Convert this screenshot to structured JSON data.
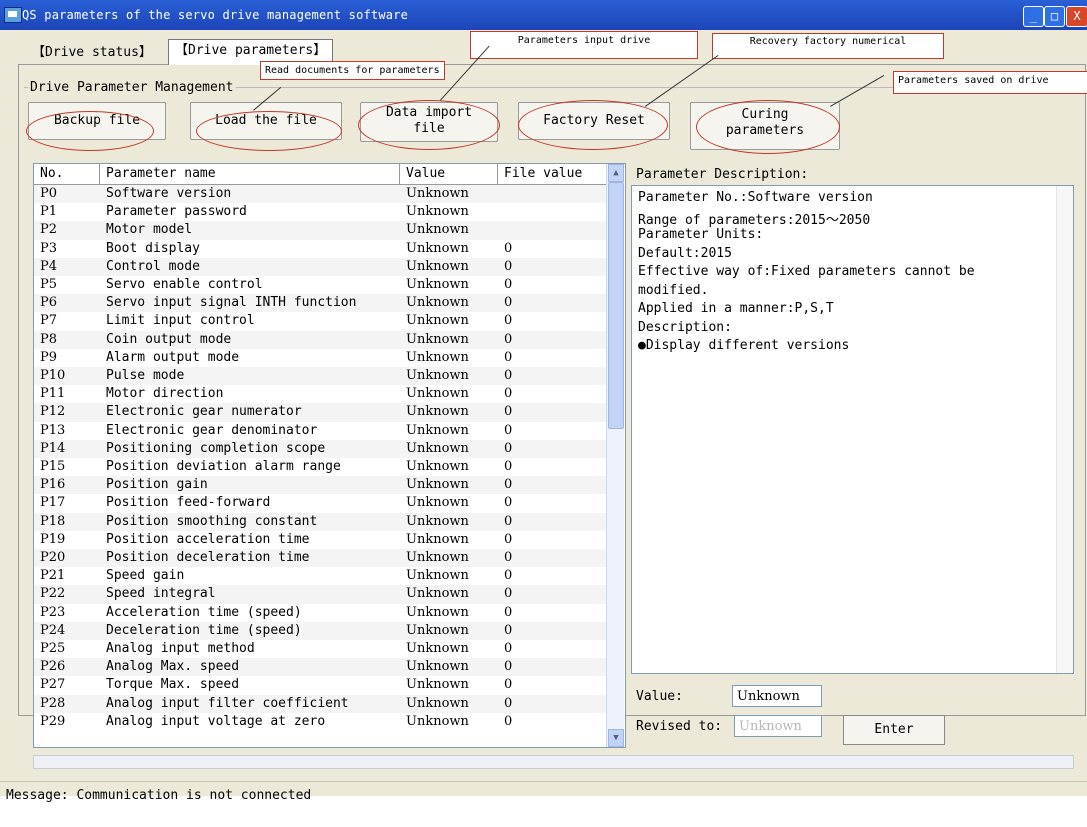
{
  "window": {
    "title": "QS parameters of the servo drive management software",
    "min_glyph": "_",
    "max_glyph": "□",
    "close_glyph": "X"
  },
  "tabs": [
    {
      "label": "【Drive status】"
    },
    {
      "label": "【Drive parameters】"
    }
  ],
  "group_title": "Drive Parameter Management",
  "buttons": {
    "backup": "Backup file",
    "load": "Load the file",
    "import_line1": "Data import",
    "import_line2": "file",
    "factory": "Factory Reset",
    "curing_line1": "Curing",
    "curing_line2": "parameters"
  },
  "annotations": {
    "read_docs": "Read documents for parameters",
    "input_drive": "Parameters input drive",
    "recovery": "Recovery factory numerical",
    "saved": "Parameters saved on drive"
  },
  "table": {
    "headers": [
      "No.",
      "Parameter name",
      "Value",
      "File value"
    ],
    "rows": [
      [
        "P0",
        "Software version",
        "Unknown",
        ""
      ],
      [
        "P1",
        "Parameter password",
        "Unknown",
        ""
      ],
      [
        "P2",
        "Motor model",
        "Unknown",
        ""
      ],
      [
        "P3",
        "Boot display",
        "Unknown",
        "0"
      ],
      [
        "P4",
        "Control mode",
        "Unknown",
        "0"
      ],
      [
        "P5",
        "Servo enable control",
        "Unknown",
        "0"
      ],
      [
        "P6",
        "Servo input signal INTH function",
        "Unknown",
        "0"
      ],
      [
        "P7",
        "Limit input control",
        "Unknown",
        "0"
      ],
      [
        "P8",
        "Coin output mode",
        "Unknown",
        "0"
      ],
      [
        "P9",
        "Alarm output mode",
        "Unknown",
        "0"
      ],
      [
        "P10",
        "Pulse mode",
        "Unknown",
        "0"
      ],
      [
        "P11",
        "Motor direction",
        "Unknown",
        "0"
      ],
      [
        "P12",
        "Electronic gear numerator",
        "Unknown",
        "0"
      ],
      [
        "P13",
        "Electronic gear denominator",
        "Unknown",
        "0"
      ],
      [
        "P14",
        "Positioning completion scope",
        "Unknown",
        "0"
      ],
      [
        "P15",
        "Position deviation alarm range",
        "Unknown",
        "0"
      ],
      [
        "P16",
        "Position gain",
        "Unknown",
        "0"
      ],
      [
        "P17",
        "Position feed-forward",
        "Unknown",
        "0"
      ],
      [
        "P18",
        "Position smoothing constant",
        "Unknown",
        "0"
      ],
      [
        "P19",
        "Position acceleration time",
        "Unknown",
        "0"
      ],
      [
        "P20",
        "Position deceleration time",
        "Unknown",
        "0"
      ],
      [
        "P21",
        "Speed gain",
        "Unknown",
        "0"
      ],
      [
        "P22",
        "Speed integral",
        "Unknown",
        "0"
      ],
      [
        "P23",
        "Acceleration time (speed)",
        "Unknown",
        "0"
      ],
      [
        "P24",
        "Deceleration time (speed)",
        "Unknown",
        "0"
      ],
      [
        "P25",
        "Analog input method",
        "Unknown",
        "0"
      ],
      [
        "P26",
        "Analog Max. speed",
        "Unknown",
        "0"
      ],
      [
        "P27",
        "Torque Max. speed",
        "Unknown",
        "0"
      ],
      [
        "P28",
        "Analog input filter coefficient",
        "Unknown",
        "0"
      ],
      [
        "P29",
        "Analog input voltage at zero",
        "Unknown",
        "0"
      ]
    ]
  },
  "description": {
    "title": "Parameter Description:",
    "lines": [
      "Parameter No.:Software version",
      "Range of parameters:2015～2050",
      "Parameter Units:",
      "Default:2015",
      "Effective way of:Fixed parameters cannot be",
      "modified.",
      "Applied in a manner:P,S,T",
      "Description:",
      "●Display different versions"
    ]
  },
  "value_label": "Value:",
  "value": "Unknown",
  "revised_label": "Revised to:",
  "revised_placeholder": "Unknown",
  "enter_label": "Enter",
  "status_message": "Message: Communication is not connected"
}
